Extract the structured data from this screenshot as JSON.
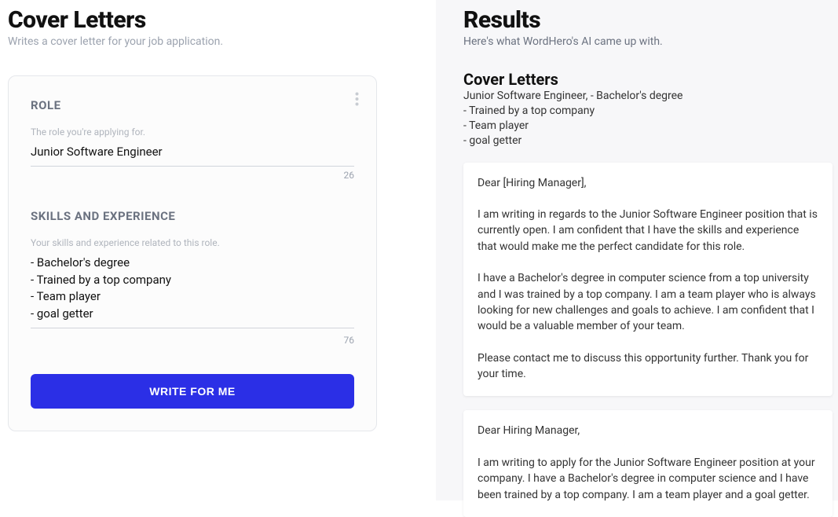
{
  "left": {
    "title": "Cover Letters",
    "subtitle": "Writes a cover letter for your job application.",
    "role": {
      "label": "ROLE",
      "hint": "The role you're applying for.",
      "value": "Junior Software Engineer",
      "count": "26"
    },
    "skills": {
      "label": "SKILLS AND EXPERIENCE",
      "hint": "Your skills and experience related to this role.",
      "value": "- Bachelor's degree\n- Trained by a top company\n- Team player\n- goal getter",
      "count": "76"
    },
    "button": "WRITE FOR ME"
  },
  "right": {
    "title": "Results",
    "subtitle": "Here's what WordHero's AI came up with.",
    "meta": {
      "heading": "Cover Letters",
      "line1": "Junior Software Engineer, - Bachelor's degree",
      "line2": "- Trained by a top company",
      "line3": "- Team player",
      "line4": "- goal getter"
    },
    "cards": [
      "Dear [Hiring Manager],\n\nI am writing in regards to the Junior Software Engineer position that is currently open. I am confident that I have the skills and experience that would make me the perfect candidate for this role.\n\nI have a Bachelor's degree in computer science from a top university and I was trained by a top company. I am a team player who is always looking for new challenges and goals to achieve. I am confident that I would be a valuable member of your team.\n\nPlease contact me to discuss this opportunity further. Thank you for your time.",
      "Dear Hiring Manager,\n\nI am writing to apply for the Junior Software Engineer position at your company. I have a Bachelor's degree in computer science and I have been trained by a top company. I am a team player and a goal getter."
    ]
  }
}
